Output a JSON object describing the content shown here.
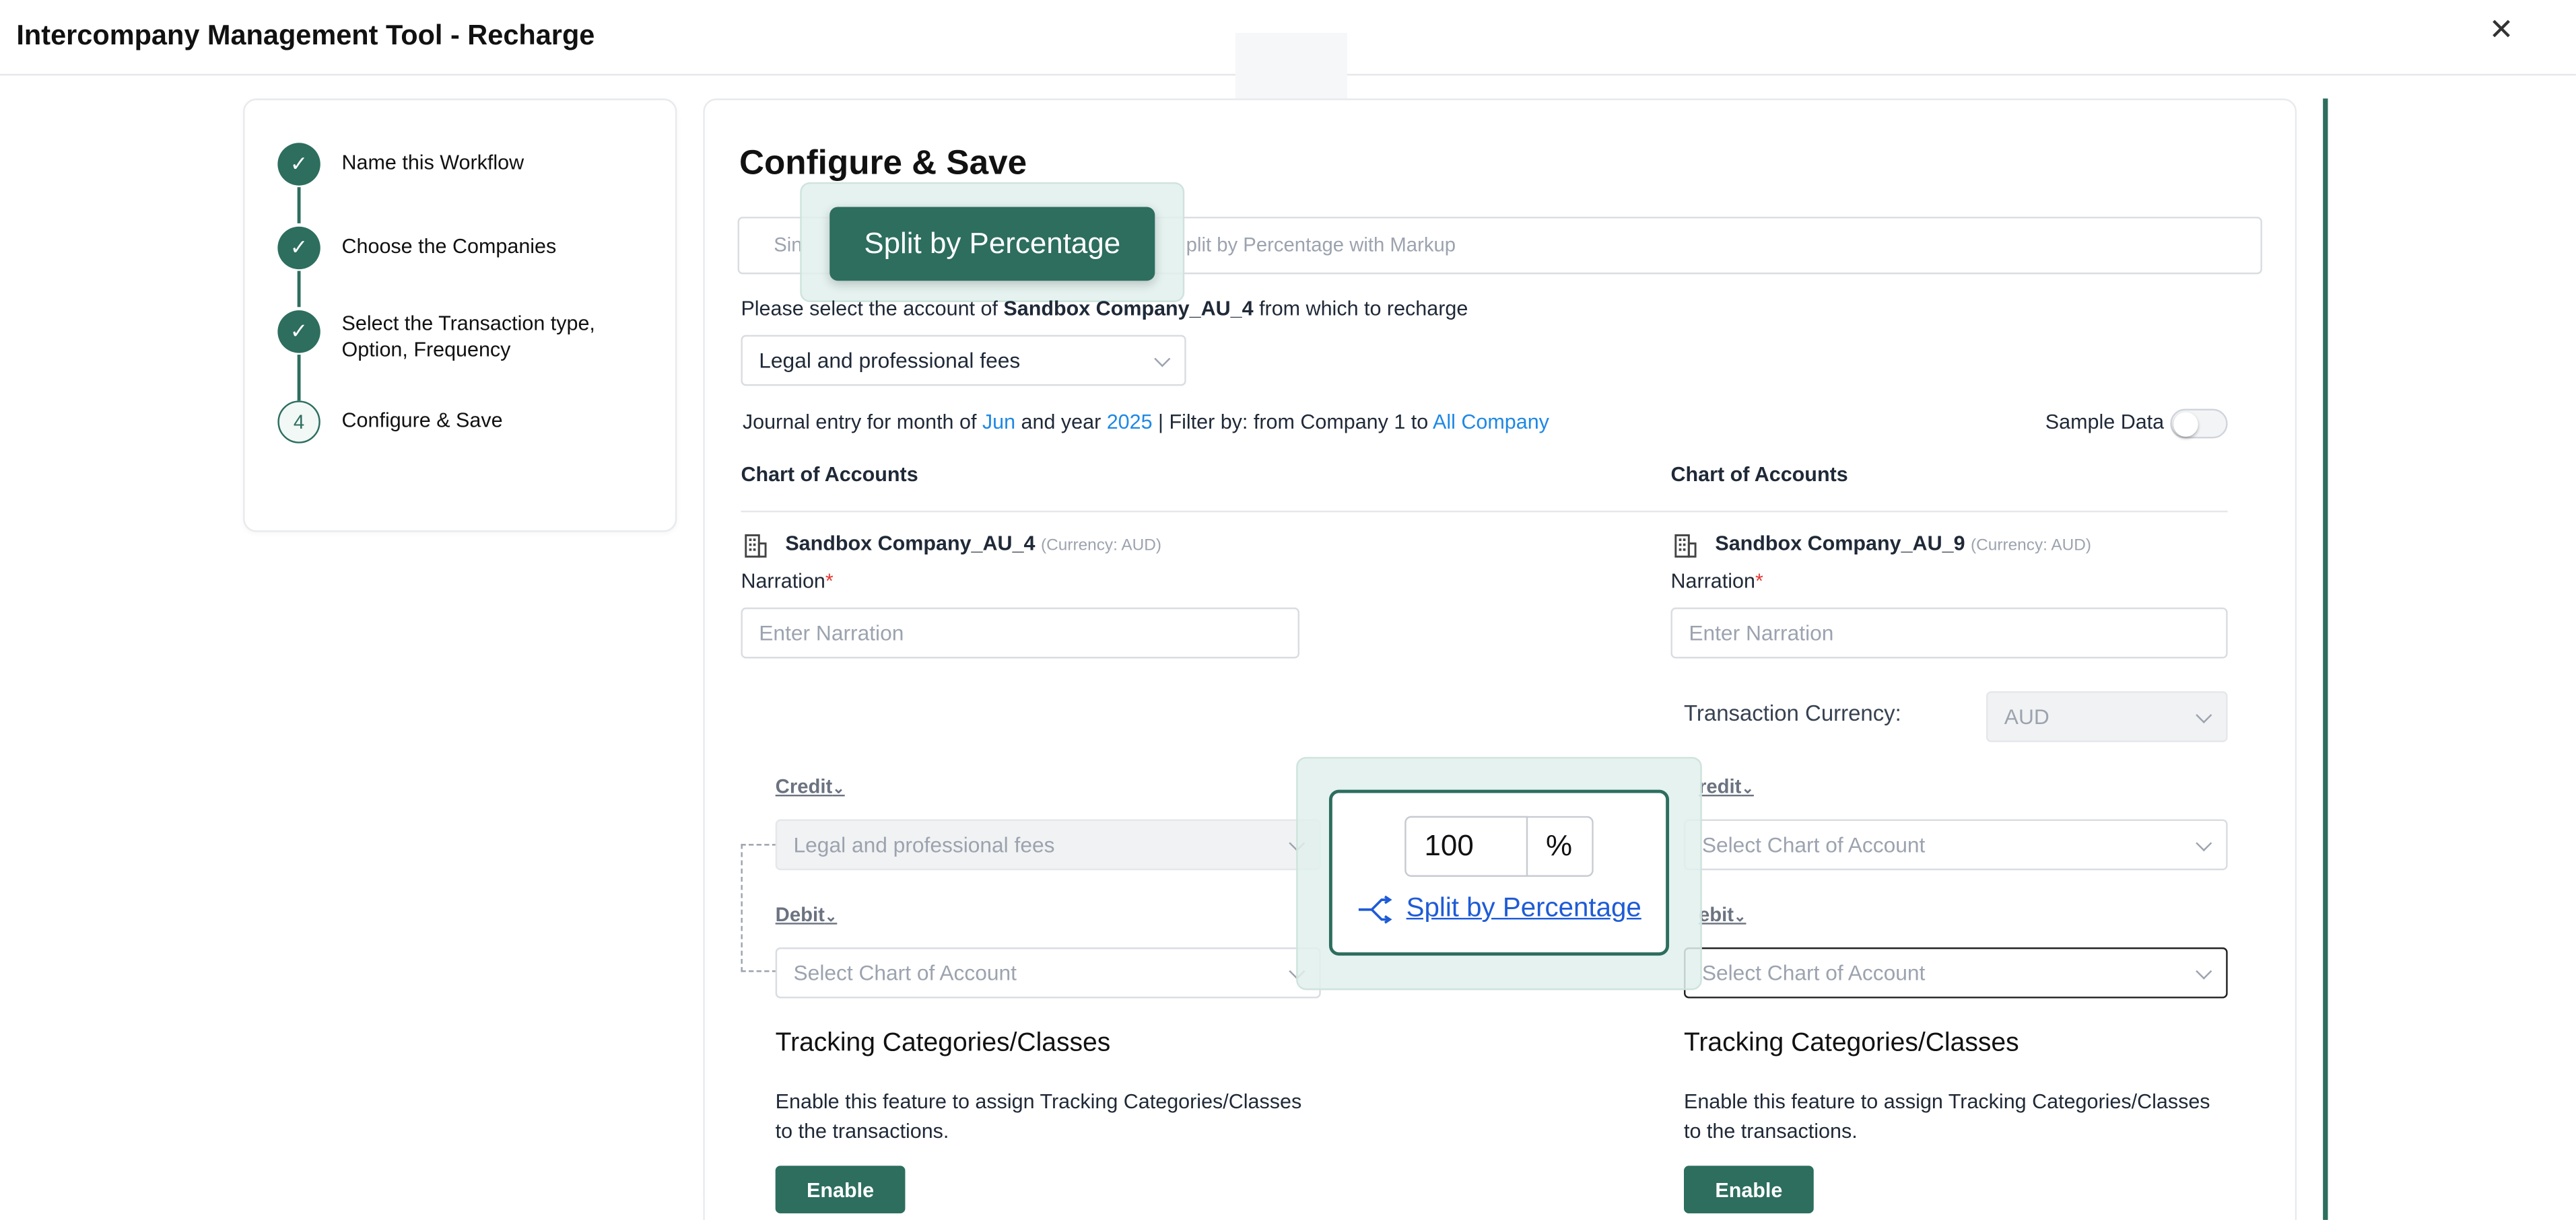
{
  "app": {
    "title": "Intercompany Management Tool - Recharge",
    "close_icon": "close-icon"
  },
  "stepper": {
    "steps": [
      {
        "label": "Name this Workflow",
        "status": "done"
      },
      {
        "label": "Choose the Companies",
        "status": "done"
      },
      {
        "label_line1": "Select the Transaction type,",
        "label_line2": "Option, Frequency",
        "status": "done"
      },
      {
        "label": "Configure & Save",
        "number": "4",
        "status": "current"
      }
    ]
  },
  "main": {
    "heading": "Configure & Save",
    "tabs": {
      "left_partial": "Sin",
      "active": "Split by Percentage",
      "right_partial": "plit by Percentage with Markup"
    },
    "account_prompt": {
      "prefix": "Please select the account of ",
      "company": "Sandbox Company_AU_4",
      "suffix": " from which to recharge"
    },
    "account_select": {
      "value": "Legal and professional fees"
    },
    "journal": {
      "prefix": "Journal entry for month of ",
      "month": "Jun",
      "mid": " and year ",
      "year": "2025",
      "filter": " | Filter by: from Company 1 to ",
      "to": "All Company"
    },
    "sample_data": {
      "label": "Sample Data",
      "enabled": false
    },
    "left": {
      "coa_heading": "Chart of Accounts",
      "company": "Sandbox Company_AU_4",
      "currency": "(Currency: AUD)",
      "narration_label": "Narration",
      "narration_required": "*",
      "narration_placeholder": "Enter Narration",
      "credit_label": "Credit",
      "credit_value": "Legal and professional fees",
      "debit_label": "Debit",
      "debit_placeholder": "Select Chart of Account",
      "tracking_heading": "Tracking Categories/Classes",
      "tracking_desc_1": "Enable this feature to assign Tracking Categories/Classes",
      "tracking_desc_2": "to the transactions.",
      "enable_label": "Enable"
    },
    "right": {
      "coa_heading": "Chart of Accounts",
      "company": "Sandbox Company_AU_9",
      "currency": "(Currency: AUD)",
      "narration_label": "Narration",
      "narration_required": "*",
      "narration_placeholder": "Enter Narration",
      "transaction_currency_label": "Transaction Currency:",
      "transaction_currency_value": "AUD",
      "credit_label": "redit",
      "credit_placeholder": "Select Chart of Account",
      "debit_label": "ebit",
      "debit_placeholder": "Select Chart of Account",
      "tracking_heading": "Tracking Categories/Classes",
      "tracking_desc_1": "Enable this feature to assign Tracking Categories/Classes",
      "tracking_desc_2": "to the transactions.",
      "enable_label": "Enable"
    },
    "split_popup": {
      "percent_value": "100",
      "percent_sign": "%",
      "link_label": "Split by Percentage",
      "icon": "split-icon"
    }
  },
  "colors": {
    "brand": "#2d6e5e",
    "link": "#1e88e5",
    "required": "#e53935"
  }
}
